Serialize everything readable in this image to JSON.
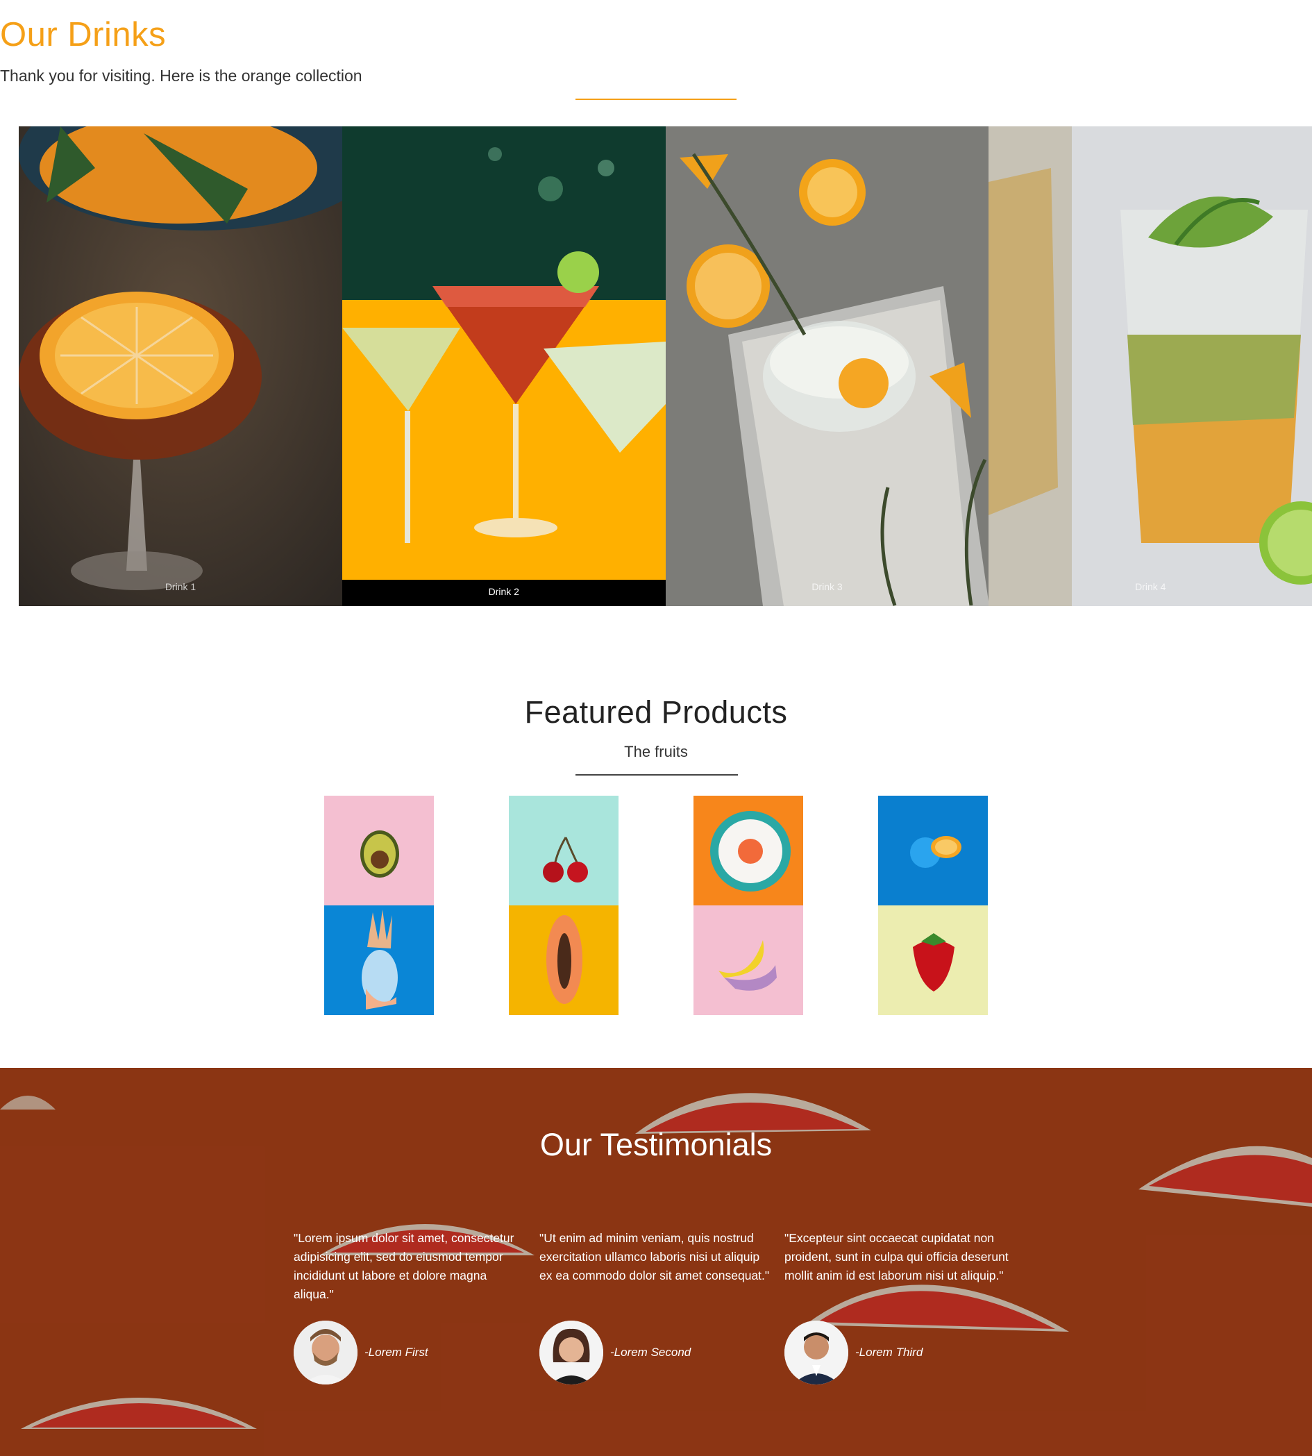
{
  "drinks": {
    "title": "Our Drinks",
    "subtitle": "Thank you for visiting. Here is the orange collection",
    "accent": "#f5a018",
    "items": [
      {
        "label": "Drink 1"
      },
      {
        "label": "Drink 2"
      },
      {
        "label": "Drink 3"
      },
      {
        "label": "Drink 4"
      }
    ]
  },
  "featured": {
    "title": "Featured Products",
    "subtitle": "The fruits",
    "fruits": [
      {
        "name": "avocado",
        "bg": "#f4bfd1"
      },
      {
        "name": "pineapple",
        "bg": "#0a86d6"
      },
      {
        "name": "cherries",
        "bg": "#a9e5dc"
      },
      {
        "name": "papaya",
        "bg": "#f5b400"
      },
      {
        "name": "grapefruit-plate",
        "bg": "#f7861b"
      },
      {
        "name": "banana",
        "bg": "#f4bfd1"
      },
      {
        "name": "blue-orange",
        "bg": "#0a7fcf"
      },
      {
        "name": "strawberry",
        "bg": "#ecedb0"
      }
    ]
  },
  "testimonials": {
    "title": "Our Testimonials",
    "bg": "#a23a13",
    "items": [
      {
        "quote": "\"Lorem ipsum dolor sit amet, consectetur adipisicing elit, sed do eiusmod tempor incididunt ut labore et dolore magna aliqua.\"",
        "name": "-Lorem First"
      },
      {
        "quote": "\"Ut enim ad minim veniam, quis nostrud exercitation ullamco laboris nisi ut aliquip ex ea commodo dolor sit amet consequat.\"",
        "name": "-Lorem Second"
      },
      {
        "quote": "\"Excepteur sint occaecat cupidatat non proident, sunt in culpa qui officia deserunt mollit anim id est laborum nisi ut aliquip.\"",
        "name": "-Lorem Third"
      }
    ]
  }
}
